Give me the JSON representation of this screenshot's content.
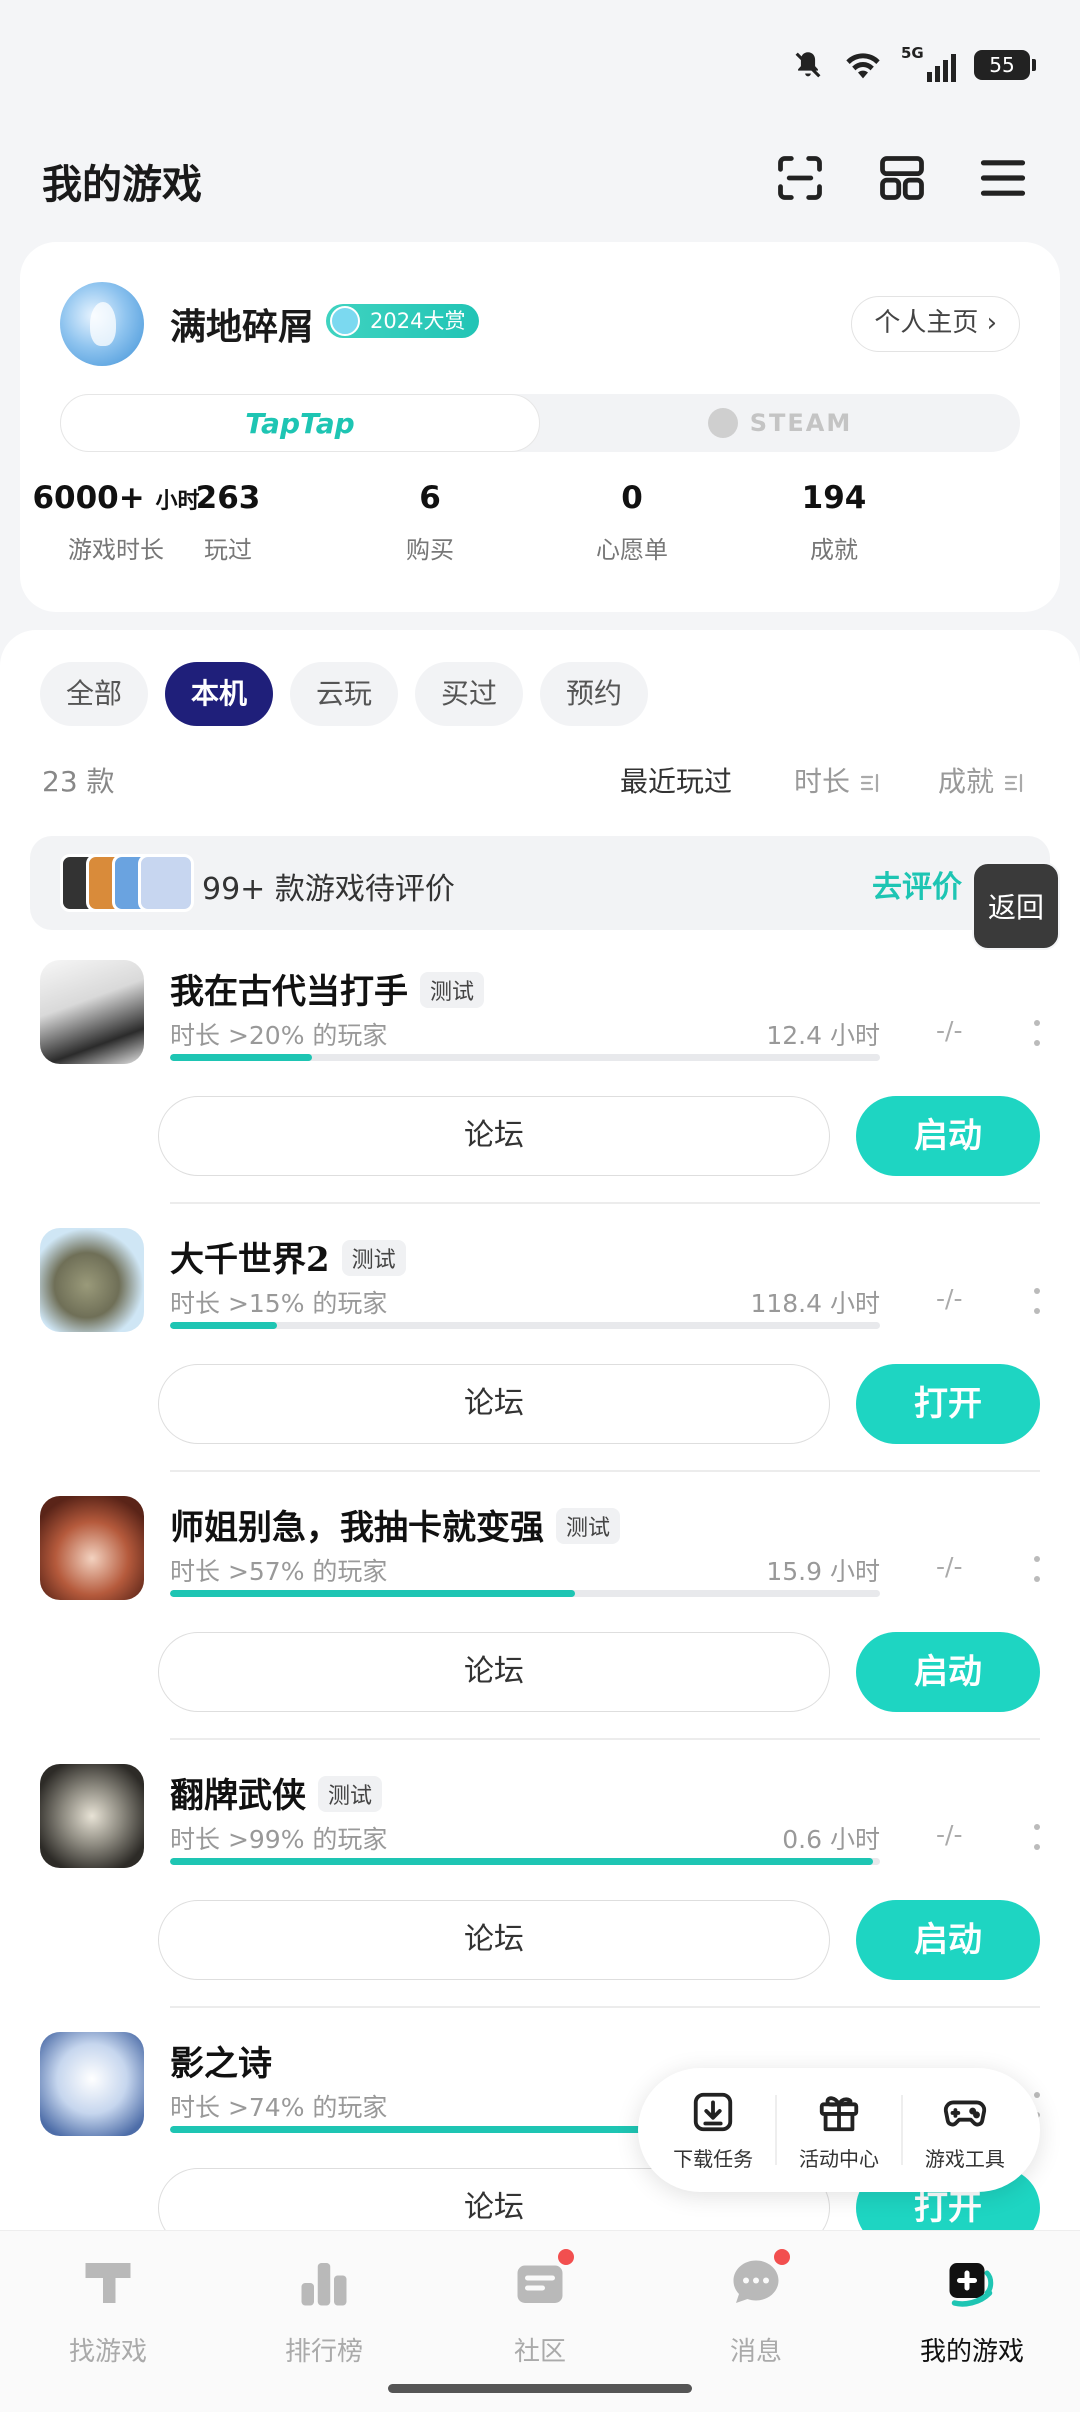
{
  "status_bar": {
    "network": "5G",
    "battery": "55"
  },
  "header": {
    "title": "我的游戏"
  },
  "profile": {
    "username": "满地碎屑",
    "award_badge": "2024大赏",
    "homepage_label": "个人主页 ›",
    "platforms": {
      "taptap": "TapTap",
      "steam": "STEAM"
    },
    "stats": [
      {
        "value": "6000+",
        "unit": "小时",
        "label": "游戏时长"
      },
      {
        "value": "263",
        "unit": "",
        "label": "玩过"
      },
      {
        "value": "6",
        "unit": "",
        "label": "购买"
      },
      {
        "value": "0",
        "unit": "",
        "label": "心愿单"
      },
      {
        "value": "194",
        "unit": "",
        "label": "成就"
      }
    ]
  },
  "filters": [
    "全部",
    "本机",
    "云玩",
    "买过",
    "预约"
  ],
  "active_filter": "本机",
  "list": {
    "count": "23 款",
    "sort": {
      "recent": "最近玩过",
      "duration": "时长",
      "achievement": "成就"
    }
  },
  "review_bar": {
    "text": "99+ 款游戏待评价",
    "link": "去评价"
  },
  "back_button": "返回",
  "games": [
    {
      "name": "我在古代当打手",
      "tag": "测试",
      "percentile": "时长 >20% 的玩家",
      "progress": 0.2,
      "hours": "12.4 小时",
      "achievement": "-/-",
      "forum": "论坛",
      "action": "启动"
    },
    {
      "name": "大千世界2",
      "tag": "测试",
      "percentile": "时长 >15% 的玩家",
      "progress": 0.15,
      "hours": "118.4 小时",
      "achievement": "-/-",
      "forum": "论坛",
      "action": "打开"
    },
    {
      "name": "师姐别急，我抽卡就变强",
      "tag": "测试",
      "percentile": "时长 >57% 的玩家",
      "progress": 0.57,
      "hours": "15.9 小时",
      "achievement": "-/-",
      "forum": "论坛",
      "action": "启动"
    },
    {
      "name": "翻牌武侠",
      "tag": "测试",
      "percentile": "时长 >99% 的玩家",
      "progress": 0.99,
      "hours": "0.6 小时",
      "achievement": "-/-",
      "forum": "论坛",
      "action": "启动"
    },
    {
      "name": "影之诗",
      "tag": "",
      "percentile": "时长 >74% 的玩家",
      "progress": 0.74,
      "hours": "",
      "achievement": "",
      "forum": "论坛",
      "action": "打开"
    }
  ],
  "tools": [
    {
      "label": "下载任务",
      "icon": "download-icon"
    },
    {
      "label": "活动中心",
      "icon": "gift-icon"
    },
    {
      "label": "游戏工具",
      "icon": "gamepad-icon"
    }
  ],
  "bottom_nav": [
    {
      "label": "找游戏",
      "icon": "find-game-icon",
      "badge": false
    },
    {
      "label": "排行榜",
      "icon": "ranking-icon",
      "badge": false
    },
    {
      "label": "社区",
      "icon": "community-icon",
      "badge": true
    },
    {
      "label": "消息",
      "icon": "message-icon",
      "badge": true
    },
    {
      "label": "我的游戏",
      "icon": "my-games-icon",
      "badge": false
    }
  ],
  "colors": {
    "accent": "#1ec5b3",
    "active_chip": "#1f1f7a",
    "badge_red": "#f24f4f"
  }
}
